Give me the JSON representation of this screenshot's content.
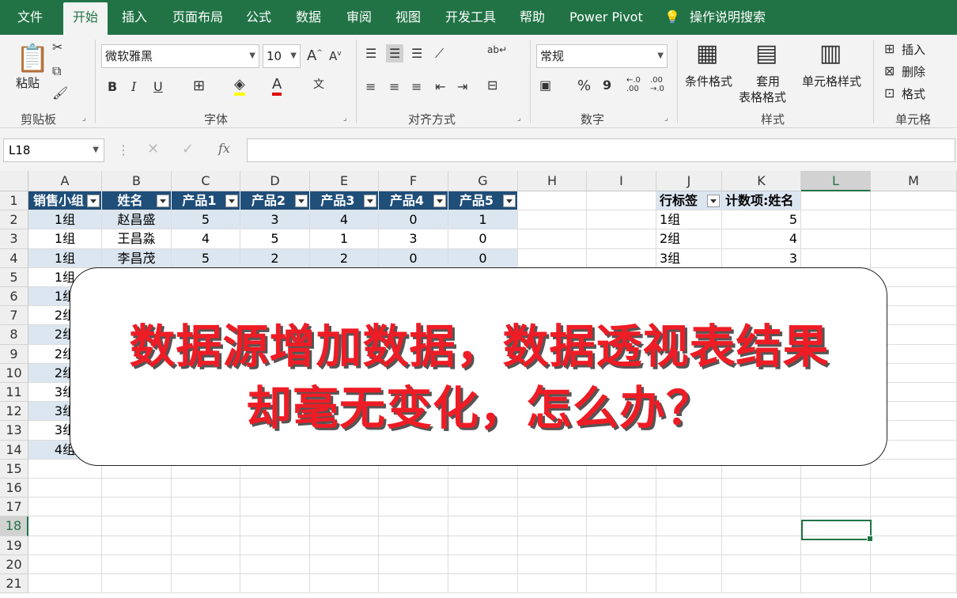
{
  "tabs": [
    "文件",
    "开始",
    "插入",
    "页面布局",
    "公式",
    "数据",
    "审阅",
    "视图",
    "开发工具",
    "帮助",
    "Power Pivot"
  ],
  "tell_me": "操作说明搜索",
  "ribbon": {
    "clipboard": {
      "paste": "粘贴",
      "group": "剪贴板"
    },
    "font": {
      "name": "微软雅黑",
      "size": "10",
      "group": "字体",
      "bold": "B",
      "italic": "I",
      "underline": "U"
    },
    "align": {
      "group": "对齐方式"
    },
    "number": {
      "format": "常规",
      "group": "数字",
      "percent": "%",
      "comma": "9"
    },
    "styles": {
      "conditional": "条件格式",
      "table_line1": "套用",
      "table_line2": "表格格式",
      "cell_styles": "单元格样式",
      "group": "样式"
    },
    "cells": {
      "insert": "插入",
      "delete": "删除",
      "format": "格式",
      "group": "单元格"
    }
  },
  "name_box": "L18",
  "fx": "fx",
  "columns": [
    "A",
    "B",
    "C",
    "D",
    "E",
    "F",
    "G",
    "H",
    "I",
    "J",
    "K",
    "L",
    "M"
  ],
  "rows": [
    "1",
    "2",
    "3",
    "4",
    "5",
    "6",
    "7",
    "8",
    "9",
    "10",
    "11",
    "12",
    "13",
    "14",
    "15",
    "16",
    "17",
    "18",
    "19",
    "20",
    "21"
  ],
  "table_headers": [
    "销售小组",
    "姓名",
    "产品1",
    "产品2",
    "产品3",
    "产品4",
    "产品5"
  ],
  "table_rows": [
    [
      "1组",
      "赵昌盛",
      "5",
      "3",
      "4",
      "0",
      "1"
    ],
    [
      "1组",
      "王昌淼",
      "4",
      "5",
      "1",
      "3",
      "0"
    ],
    [
      "1组",
      "李昌茂",
      "5",
      "2",
      "2",
      "0",
      "0"
    ]
  ],
  "col_a_rest": [
    "1组",
    "1组",
    "2组",
    "2组",
    "2组",
    "2组",
    "3组",
    "3组",
    "3组",
    "4组"
  ],
  "pivot": {
    "header_label": "行标签",
    "header_value": "计数项:姓名",
    "rows": [
      [
        "1组",
        "5"
      ],
      [
        "2组",
        "4"
      ],
      [
        "3组",
        "3"
      ]
    ]
  },
  "overlay": {
    "line1": "数据源增加数据，数据透视表结果",
    "line2": "却毫无变化，怎么办？"
  },
  "colors": {
    "excel_green": "#217346",
    "table_header": "#1f4e79",
    "table_band": "#dce6f1",
    "overlay_text": "#ee1c25"
  }
}
